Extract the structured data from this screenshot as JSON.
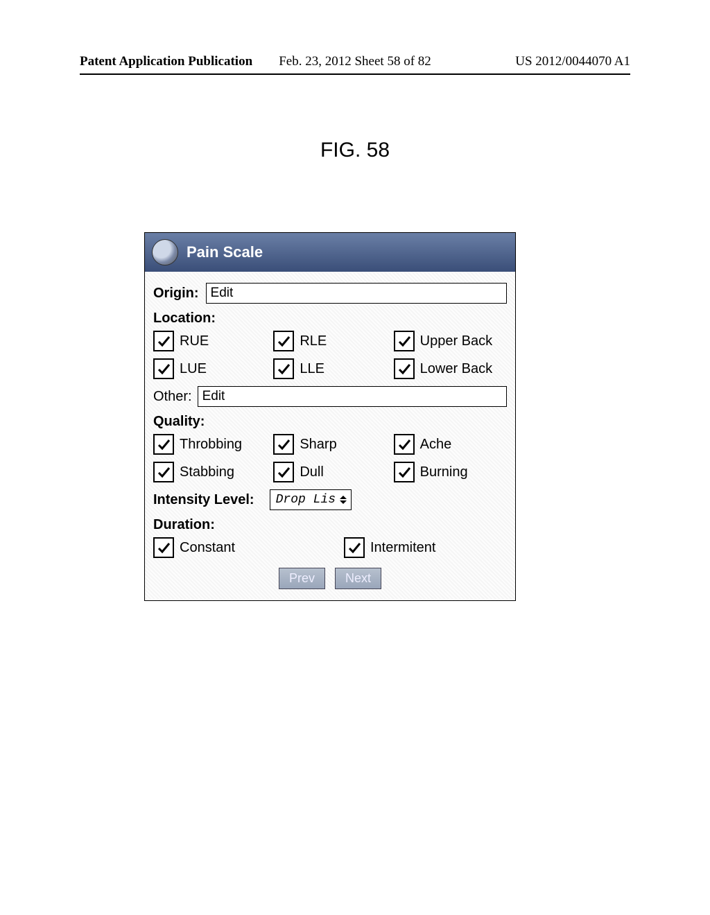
{
  "header": {
    "left": "Patent Application Publication",
    "center": "Feb. 23, 2012  Sheet 58 of 82",
    "right": "US 2012/0044070 A1"
  },
  "figure_caption": "FIG. 58",
  "panel": {
    "title": "Pain Scale",
    "origin": {
      "label": "Origin:",
      "edit_text": "Edit"
    },
    "location": {
      "label": "Location:",
      "items": [
        "RUE",
        "RLE",
        "Upper Back",
        "LUE",
        "LLE",
        "Lower Back"
      ],
      "other_label": "Other:",
      "other_edit_text": "Edit"
    },
    "quality": {
      "label": "Quality:",
      "items": [
        "Throbbing",
        "Sharp",
        "Ache",
        "Stabbing",
        "Dull",
        "Burning"
      ]
    },
    "intensity": {
      "label": "Intensity Level:",
      "drop_text": "Drop Lis"
    },
    "duration": {
      "label": "Duration:",
      "items": [
        "Constant",
        "Intermitent"
      ]
    },
    "nav": {
      "prev": "Prev",
      "next": "Next"
    }
  }
}
